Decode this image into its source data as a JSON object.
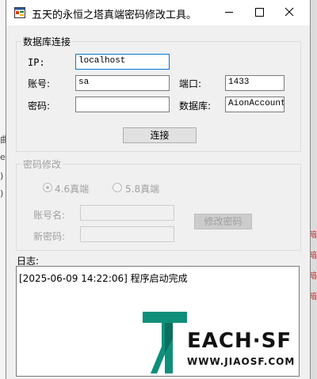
{
  "window": {
    "title": "五天的永恒之塔真端密码修改工具。"
  },
  "background": {
    "left_fragments": [
      "曲",
      "e",
      ")",
      ")"
    ],
    "right_fragments": [
      "暗",
      "暗",
      "暗",
      "暗"
    ]
  },
  "db_group": {
    "legend": "数据库连接",
    "ip_label": "IP:",
    "ip_value": "localhost",
    "user_label": "账号:",
    "user_value": "sa",
    "port_label": "端口:",
    "port_value": "1433",
    "pass_label": "密码:",
    "pass_value": "",
    "db_label": "数据库:",
    "db_value": "AionAccount",
    "connect_button": "连接"
  },
  "pwd_group": {
    "legend": "密码修改",
    "radio_46": "4.6真端",
    "radio_58": "5.8真端",
    "account_label": "账号名:",
    "account_value": "",
    "newpass_label": "新密码:",
    "newpass_value": "",
    "modify_button": "修改密码"
  },
  "log": {
    "label": "日志:",
    "lines": [
      "[2025-06-09 14:22:06] 程序启动完成"
    ]
  },
  "watermark": {
    "brand": "EACH·SF",
    "url": "WWW.JIAOSF.COM"
  },
  "icons": {
    "app": "app-window-icon",
    "min": "minimize-icon",
    "max": "maximize-icon",
    "close": "close-icon"
  }
}
